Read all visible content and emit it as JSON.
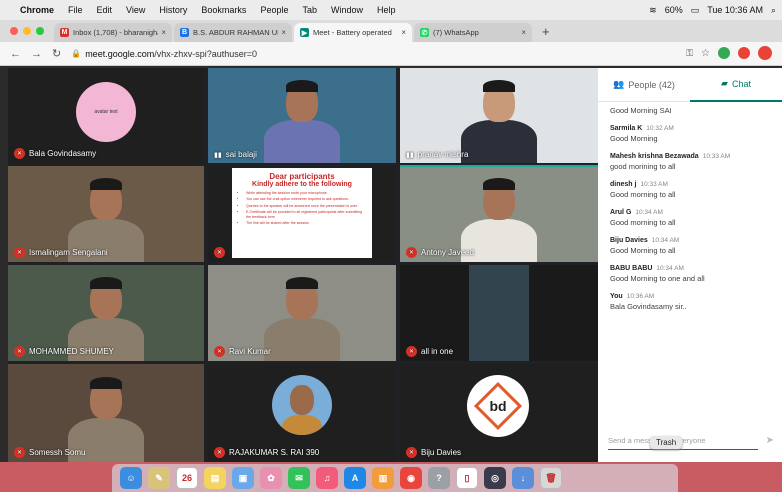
{
  "menubar": {
    "app": "Chrome",
    "items": [
      "File",
      "Edit",
      "View",
      "History",
      "Bookmarks",
      "People",
      "Tab",
      "Window",
      "Help"
    ],
    "battery": "60%",
    "clock": "Tue 10:36 AM"
  },
  "tabs": [
    {
      "label": "Inbox (1,708) - bharanigha@...",
      "icon": "gmail-icon",
      "color": "#d93025",
      "glyph": "M"
    },
    {
      "label": "B.S. ABDUR RAHMAN UNIVE...",
      "icon": "university-icon",
      "color": "#1a73e8",
      "glyph": "B"
    },
    {
      "label": "Meet - Battery operated",
      "icon": "meet-icon",
      "color": "#00897b",
      "glyph": "▶",
      "active": true
    },
    {
      "label": "(7) WhatsApp",
      "icon": "whatsapp-icon",
      "color": "#25d366",
      "glyph": "✆"
    }
  ],
  "address": {
    "url_host": "meet.google.com",
    "url_path": "/vhx-zhxv-spi?authuser=0"
  },
  "tiles": [
    {
      "name": "Bala Govindasamy",
      "bg": "#1f1f1f",
      "muted": true,
      "kind": "avatar-text"
    },
    {
      "name": "sai balaji",
      "bg": "#3b6f8c",
      "muted": false,
      "kind": "person"
    },
    {
      "name": "pranav mishra",
      "bg": "#dfe3e6",
      "muted": false,
      "kind": "person-suit"
    },
    {
      "name": "Ismalingam Sengalani",
      "bg": "#6b5a48",
      "muted": true,
      "kind": "person"
    },
    {
      "name": "",
      "bg": "#1f1f1f",
      "muted": true,
      "kind": "slide"
    },
    {
      "name": "Antony Javeed",
      "bg": "#8a8f86",
      "muted": true,
      "kind": "person"
    },
    {
      "name": "MOHAMMED SHUMEY",
      "bg": "#4b5a4a",
      "muted": true,
      "kind": "person"
    },
    {
      "name": "Ravi Kumar",
      "bg": "#8e8e86",
      "muted": true,
      "kind": "person"
    },
    {
      "name": "all in one",
      "bg": "#1a1a1a",
      "muted": true,
      "kind": "blur"
    },
    {
      "name": "Somessh Somu",
      "bg": "#5a4a3e",
      "muted": true,
      "kind": "person"
    },
    {
      "name": "RAJAKUMAR S. RAI 390",
      "bg": "#1f1f1f",
      "muted": true,
      "kind": "avatar-photo"
    },
    {
      "name": "Biju Davies",
      "bg": "#1f1f1f",
      "muted": true,
      "kind": "avatar-logo"
    }
  ],
  "avatar_text": "avatar text",
  "logo_text": "bd",
  "slide": {
    "title": "Dear participants",
    "subtitle": "Kindly adhere to the following",
    "bullets": [
      "While attending the session mute your microphone.",
      "You can use the chat option whenever required to ask questions.",
      "Queries to the speaker will be answered once the presentation is over.",
      "E-Certificate will be provided to all registered participants after submitting the feedback form",
      "The link will be shared after the session"
    ]
  },
  "panel": {
    "people_label": "People (42)",
    "chat_label": "Chat",
    "messages": [
      {
        "who": "",
        "time": "",
        "text": "Good Morning SAI"
      },
      {
        "who": "Sarmila K",
        "time": "10:32 AM",
        "text": "Good Morning"
      },
      {
        "who": "Mahesh krishna Bezawada",
        "time": "10:33 AM",
        "text": "good morining to all"
      },
      {
        "who": "dinesh j",
        "time": "10:33 AM",
        "text": "Good morning to all"
      },
      {
        "who": "Arul G",
        "time": "10:34 AM",
        "text": "Good morning to all"
      },
      {
        "who": "Biju Davies",
        "time": "10:34 AM",
        "text": "Good Morning to all"
      },
      {
        "who": "BABU BABU",
        "time": "10:34 AM",
        "text": "Good Morning to one and all"
      },
      {
        "who": "You",
        "time": "10:36 AM",
        "text": "Bala Govindasamy sir.."
      }
    ],
    "compose_placeholder": "Send a message to everyone"
  },
  "tooltip": "Trash",
  "dock": [
    {
      "icon": "finder-icon",
      "color": "#3b8de0",
      "glyph": "☺"
    },
    {
      "icon": "notes-icon",
      "color": "#d9c27a",
      "glyph": "✎"
    },
    {
      "icon": "calendar-icon",
      "color": "#ffffff",
      "glyph": "26"
    },
    {
      "icon": "stickies-icon",
      "color": "#f4d35e",
      "glyph": "▤"
    },
    {
      "icon": "preview-icon",
      "color": "#6aa9e9",
      "glyph": "▣"
    },
    {
      "icon": "photos-icon",
      "color": "#e98fb0",
      "glyph": "✿"
    },
    {
      "icon": "messages-icon",
      "color": "#33c159",
      "glyph": "✉"
    },
    {
      "icon": "music-icon",
      "color": "#f35b7a",
      "glyph": "♫"
    },
    {
      "icon": "appstore-icon",
      "color": "#1e88e5",
      "glyph": "A"
    },
    {
      "icon": "books-icon",
      "color": "#f39c3d",
      "glyph": "▥"
    },
    {
      "icon": "chrome-icon",
      "color": "#e8453c",
      "glyph": "◉"
    },
    {
      "icon": "help-icon",
      "color": "#9aa0a6",
      "glyph": "?"
    },
    {
      "icon": "document-icon",
      "color": "#ffffff",
      "glyph": "▯"
    },
    {
      "icon": "obs-icon",
      "color": "#3a3a4a",
      "glyph": "◎"
    },
    {
      "icon": "downloads-icon",
      "color": "#5b8fd9",
      "glyph": "↓"
    },
    {
      "icon": "trash-icon",
      "color": "#d7d7d7",
      "glyph": "🗑"
    }
  ]
}
